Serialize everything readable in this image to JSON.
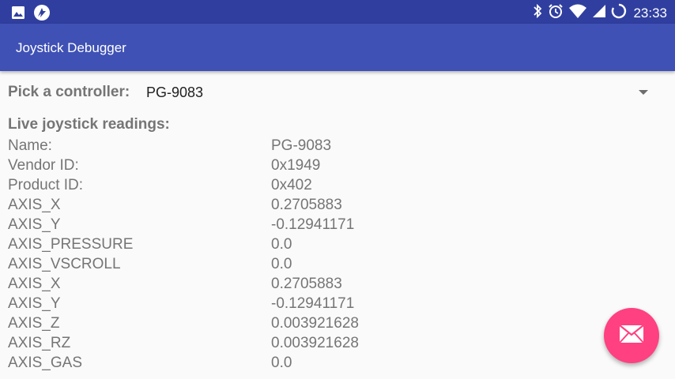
{
  "status_bar": {
    "time": "23:33",
    "left_icons": [
      "image-icon",
      "app-logo-icon"
    ],
    "right_icons": [
      "bluetooth-icon",
      "alarm-icon",
      "wifi-icon",
      "signal-icon",
      "battery-charging-icon"
    ]
  },
  "app_bar": {
    "title": "Joystick Debugger"
  },
  "picker": {
    "label": "Pick a controller:",
    "selected": "PG-9083"
  },
  "readings": {
    "title": "Live joystick readings:",
    "rows": [
      {
        "key": "Name:",
        "value": "PG-9083"
      },
      {
        "key": "Vendor ID:",
        "value": "0x1949"
      },
      {
        "key": "Product ID:",
        "value": "0x402"
      },
      {
        "key": "AXIS_X",
        "value": "0.2705883"
      },
      {
        "key": "AXIS_Y",
        "value": "-0.12941171"
      },
      {
        "key": "AXIS_PRESSURE",
        "value": "0.0"
      },
      {
        "key": "AXIS_VSCROLL",
        "value": "0.0"
      },
      {
        "key": "AXIS_X",
        "value": "0.2705883"
      },
      {
        "key": "AXIS_Y",
        "value": "-0.12941171"
      },
      {
        "key": "AXIS_Z",
        "value": "0.003921628"
      },
      {
        "key": "AXIS_RZ",
        "value": "0.003921628"
      },
      {
        "key": "AXIS_GAS",
        "value": "0.0"
      }
    ]
  },
  "fab": {
    "icon": "email-icon",
    "color": "#ff4081"
  },
  "colors": {
    "primary": "#3f51b5",
    "primary_dark": "#303f9f",
    "accent": "#ff4081"
  }
}
